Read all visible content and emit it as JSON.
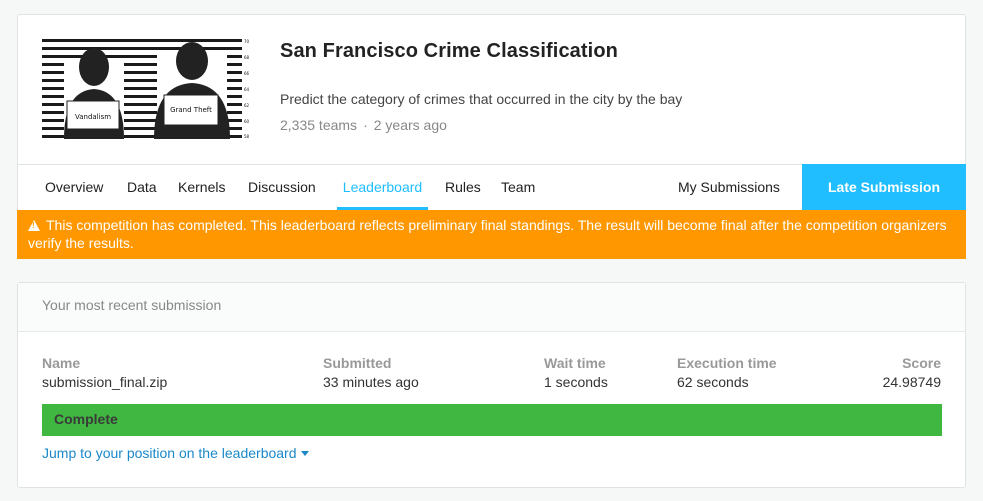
{
  "competition": {
    "banner_icon": "mugshot-lineup-icon",
    "banner_labels": [
      "Vandalism",
      "Grand Theft"
    ],
    "title": "San Francisco Crime Classification",
    "description": "Predict the category of crimes that occurred in the city by the bay",
    "teams": "2,335 teams",
    "separator": "·",
    "age": "2 years ago"
  },
  "nav": {
    "tabs": [
      {
        "label": "Overview"
      },
      {
        "label": "Data"
      },
      {
        "label": "Kernels"
      },
      {
        "label": "Discussion"
      },
      {
        "label": "Leaderboard",
        "active": true
      },
      {
        "label": "Rules"
      },
      {
        "label": "Team"
      }
    ],
    "my_submissions": "My Submissions",
    "late_submission": "Late Submission"
  },
  "alert": {
    "icon": "warning-icon",
    "text": "This competition has completed. This leaderboard reflects preliminary final standings. The result will become final after the competition organizers verify the results."
  },
  "submission": {
    "heading": "Your most recent submission",
    "columns": {
      "name": {
        "label": "Name",
        "value": "submission_final.zip"
      },
      "submitted": {
        "label": "Submitted",
        "value": "33 minutes ago"
      },
      "wait": {
        "label": "Wait time",
        "value": "1 seconds"
      },
      "execution": {
        "label": "Execution time",
        "value": "62 seconds"
      },
      "score": {
        "label": "Score",
        "value": "24.98749"
      }
    },
    "status": "Complete",
    "jump_link": "Jump to your position on the leaderboard"
  },
  "colors": {
    "accent": "#20beff",
    "alert": "#ff9700",
    "complete": "#3fb740",
    "link": "#1a88c9"
  }
}
